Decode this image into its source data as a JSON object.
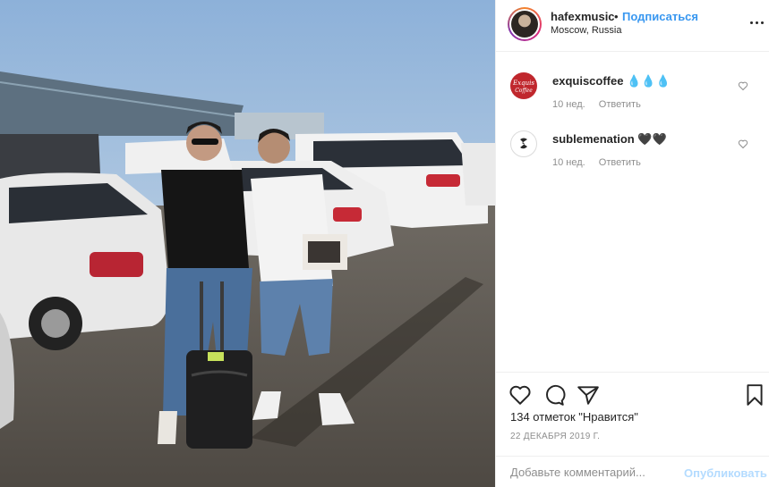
{
  "post": {
    "photo_alt": "",
    "author": {
      "username": "hafexmusic",
      "separator": "•",
      "follow_label": "Подписаться",
      "location": "Moscow, Russia"
    },
    "comments": [
      {
        "username": "exquiscoffee",
        "text": "💧💧💧",
        "time": "10 нед.",
        "reply_label": "Ответить",
        "avatar_text": "Exquis Coffee",
        "avatar_color": "#c0272d"
      },
      {
        "username": "sublemenation",
        "text": "🖤🖤",
        "time": "10 нед.",
        "reply_label": "Ответить",
        "avatar_color": "#ffffff"
      }
    ],
    "likes_text": "134 отметок \"Нравится\"",
    "date": "22 ДЕКАБРЯ 2019 Г.",
    "add_comment_placeholder": "Добавьте комментарий...",
    "post_button_label": "Опубликовать"
  },
  "colors": {
    "link_blue": "#3897f0",
    "post_disabled": "#b3dbff",
    "muted": "#8e8e8e"
  }
}
